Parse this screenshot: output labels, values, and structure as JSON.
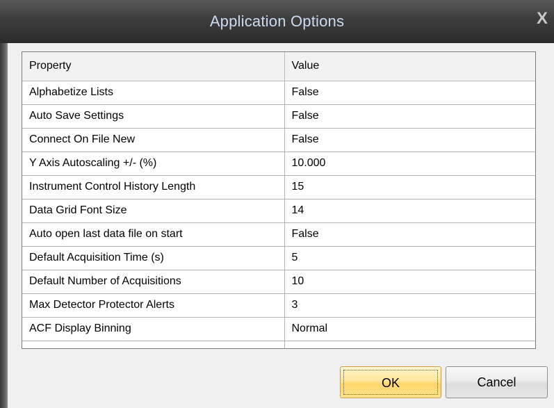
{
  "window": {
    "title": "Application Options",
    "close_glyph": "X"
  },
  "grid": {
    "columns": [
      "Property",
      "Value"
    ],
    "rows": [
      {
        "property": "Alphabetize Lists",
        "value": "False"
      },
      {
        "property": "Auto Save Settings",
        "value": "False"
      },
      {
        "property": "Connect On File New",
        "value": "False"
      },
      {
        "property": "Y Axis Autoscaling +/- (%)",
        "value": "10.000"
      },
      {
        "property": "Instrument Control History Length",
        "value": "15"
      },
      {
        "property": "Data Grid Font Size",
        "value": "14"
      },
      {
        "property": "Auto open last data file on start",
        "value": "False"
      },
      {
        "property": "Default Acquisition Time (s)",
        "value": "5"
      },
      {
        "property": "Default Number of Acquisitions",
        "value": "10"
      },
      {
        "property": "Max Detector Protector Alerts",
        "value": "3"
      },
      {
        "property": "ACF Display Binning",
        "value": "Normal"
      }
    ]
  },
  "buttons": {
    "ok_label": "OK",
    "cancel_label": "Cancel"
  },
  "colors": {
    "title_text": "#c9dcf0",
    "titlebar_bg": "#2b2b2b",
    "ok_button_bg": "#ffe38e",
    "dialog_bg": "#f0f0f0"
  }
}
